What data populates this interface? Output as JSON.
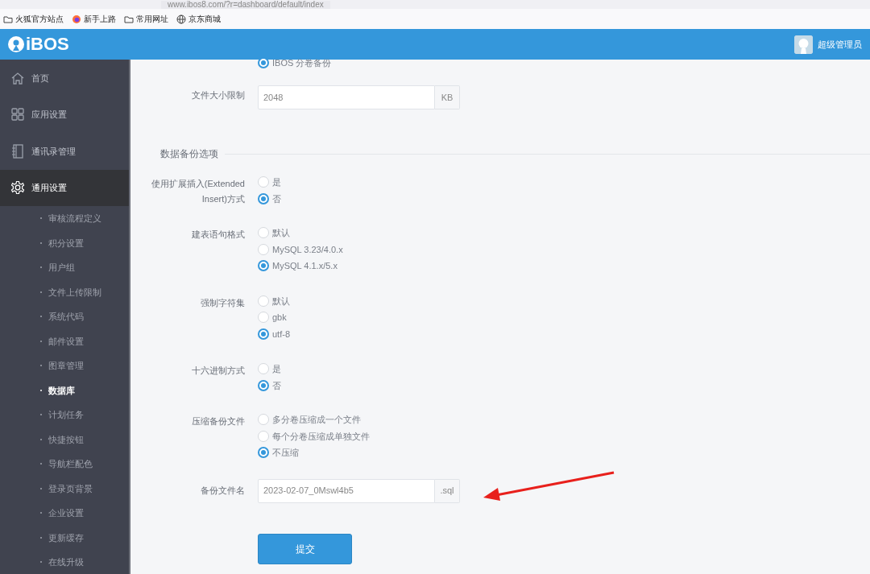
{
  "browser": {
    "url": "www.ibos8.com/?r=dashboard/default/index",
    "bookmarks": [
      {
        "label": "火狐官方站点",
        "kind": "folder"
      },
      {
        "label": "新手上路",
        "kind": "firefox"
      },
      {
        "label": "常用网址",
        "kind": "folder"
      },
      {
        "label": "京东商城",
        "kind": "globe"
      }
    ]
  },
  "header": {
    "logo": "iBOS",
    "user": "超级管理员"
  },
  "sidebar": {
    "items": [
      {
        "label": "首页",
        "kind": "home",
        "selected": false
      },
      {
        "label": "应用设置",
        "kind": "grid",
        "selected": false
      },
      {
        "label": "通讯录管理",
        "kind": "book",
        "selected": false
      },
      {
        "label": "通用设置",
        "kind": "gear",
        "selected": true,
        "children": [
          {
            "label": "审核流程定义",
            "selected": false
          },
          {
            "label": "积分设置",
            "selected": false
          },
          {
            "label": "用户组",
            "selected": false
          },
          {
            "label": "文件上传限制",
            "selected": false
          },
          {
            "label": "系统代码",
            "selected": false
          },
          {
            "label": "邮件设置",
            "selected": false
          },
          {
            "label": "图章管理",
            "selected": false
          },
          {
            "label": "数据库",
            "selected": true
          },
          {
            "label": "计划任务",
            "selected": false
          },
          {
            "label": "快捷按钮",
            "selected": false
          },
          {
            "label": "导航栏配色",
            "selected": false
          },
          {
            "label": "登录页背景",
            "selected": false
          },
          {
            "label": "企业设置",
            "selected": false
          },
          {
            "label": "更新缓存",
            "selected": false
          },
          {
            "label": "在线升级",
            "selected": false
          }
        ]
      }
    ]
  },
  "form": {
    "top_option": {
      "label": "IBOS 分卷备份",
      "selected": true
    },
    "file_size": {
      "label": "文件大小限制",
      "value": "2048",
      "unit": "KB"
    },
    "section_title": "数据备份选项",
    "groups": [
      {
        "label": "使用扩展插入(Extended Insert)方式",
        "options": [
          {
            "label": "是",
            "selected": false
          },
          {
            "label": "否",
            "selected": true
          }
        ]
      },
      {
        "label": "建表语句格式",
        "options": [
          {
            "label": "默认",
            "selected": false
          },
          {
            "label": "MySQL 3.23/4.0.x",
            "selected": false
          },
          {
            "label": "MySQL 4.1.x/5.x",
            "selected": true
          }
        ]
      },
      {
        "label": "强制字符集",
        "options": [
          {
            "label": "默认",
            "selected": false
          },
          {
            "label": "gbk",
            "selected": false
          },
          {
            "label": "utf-8",
            "selected": true
          }
        ]
      },
      {
        "label": "十六进制方式",
        "options": [
          {
            "label": "是",
            "selected": false
          },
          {
            "label": "否",
            "selected": true
          }
        ]
      },
      {
        "label": "压缩备份文件",
        "options": [
          {
            "label": "多分卷压缩成一个文件",
            "selected": false
          },
          {
            "label": "每个分卷压缩成单独文件",
            "selected": false
          },
          {
            "label": "不压缩",
            "selected": true
          }
        ]
      }
    ],
    "file_name": {
      "label": "备份文件名",
      "value": "2023-02-07_0Mswl4b5",
      "unit": ".sql"
    },
    "submit": "提交"
  }
}
